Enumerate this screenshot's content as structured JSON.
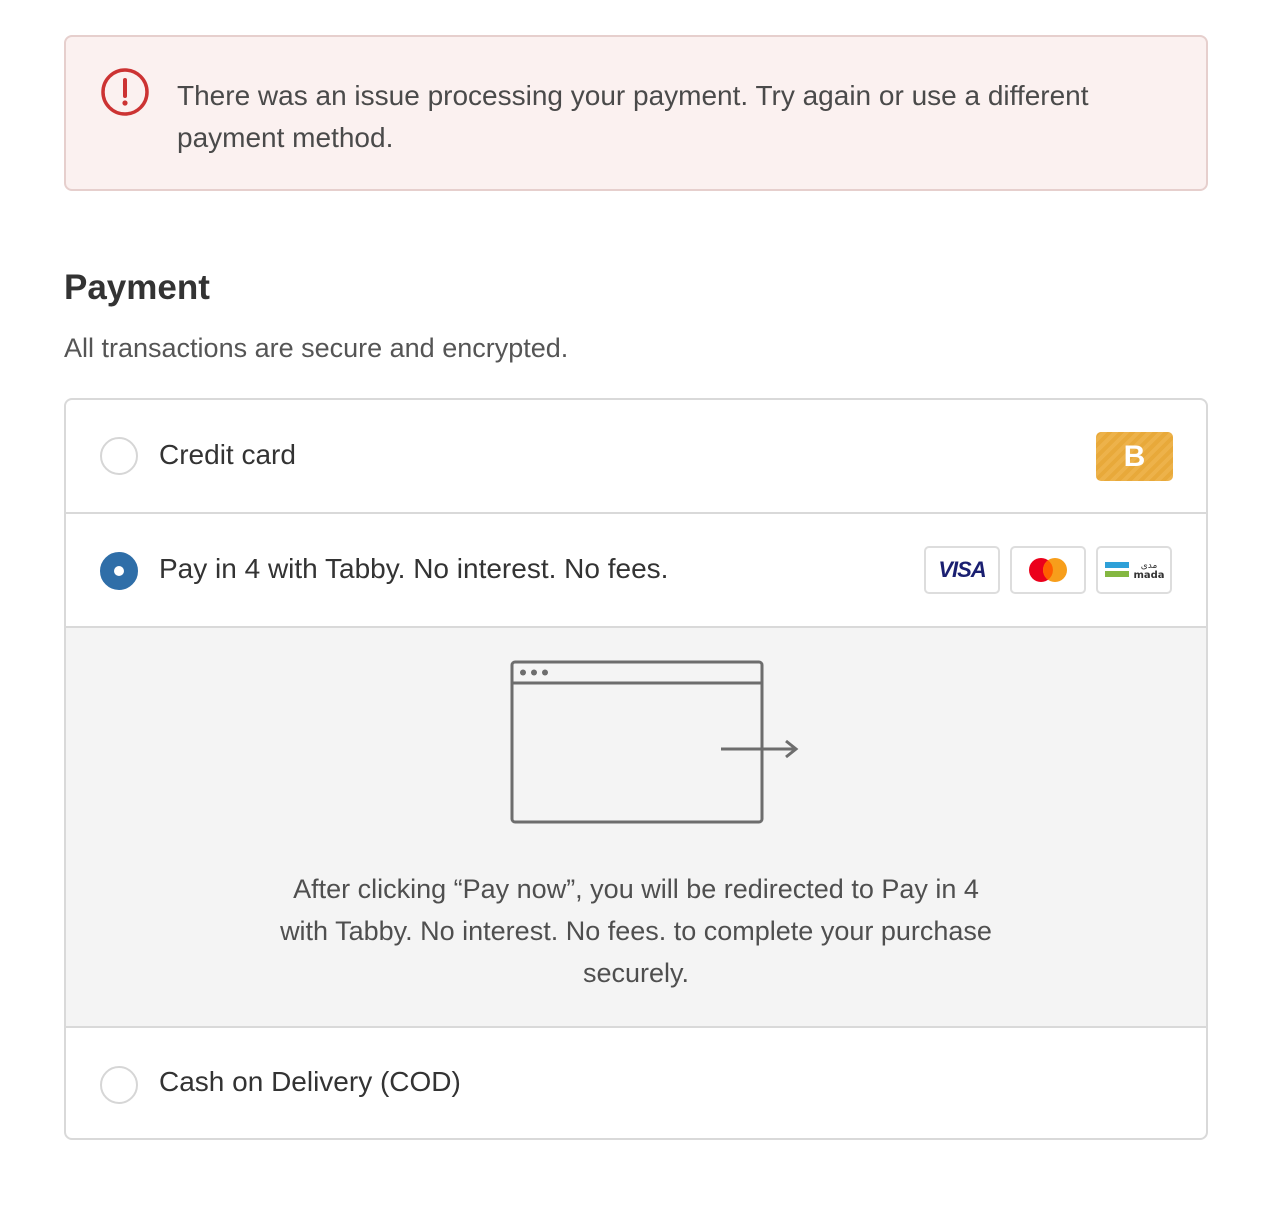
{
  "error": {
    "message": "There was an issue processing your payment. Try again or use a different payment method.",
    "icon": "alert-circle-icon",
    "color": "#cc3333"
  },
  "payment": {
    "title": "Payment",
    "subtitle": "All transactions are secure and encrypted."
  },
  "methods": [
    {
      "label": "Credit card",
      "selected": false,
      "badge": "B"
    },
    {
      "label": "Pay in 4 with Tabby. No interest. No fees.",
      "selected": true,
      "cards": [
        "VISA",
        "mastercard",
        "mada"
      ]
    },
    {
      "label": "Cash on Delivery (COD)",
      "selected": false
    }
  ],
  "cards": {
    "visa": "VISA",
    "mada_latin": "mada",
    "mada_arabic": "مدى"
  },
  "redirect": {
    "icon": "browser-redirect-icon",
    "message": "After clicking “Pay now”, you will be redirected to Pay in 4 with Tabby. No interest. No fees. to complete your purchase securely."
  },
  "colors": {
    "accent": "#2f6ea8",
    "badge": "#e8a93a",
    "error_bg": "#fbf1f0"
  }
}
